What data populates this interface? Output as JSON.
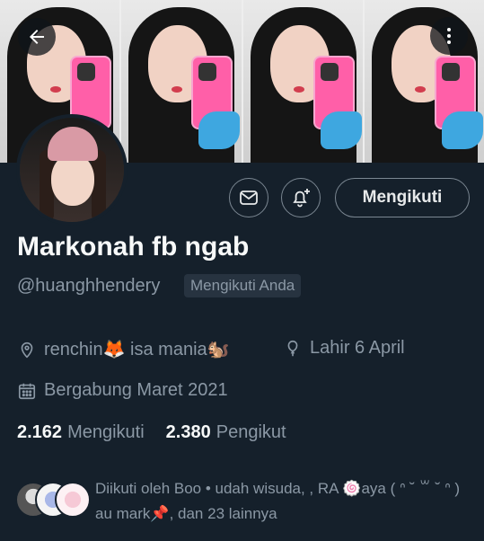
{
  "header": {
    "back_icon": "arrow-left-icon",
    "more_icon": "more-vertical-icon",
    "panels": 4
  },
  "profile": {
    "name": "Markonah fb ngab",
    "handle": "@huanghhendery",
    "follows_you": "Mengikuti Anda",
    "location": "renchin🦊 isa mania🐿️",
    "birthday": "Lahir 6 April",
    "joined": "Bergabung Maret 2021"
  },
  "actions": {
    "message_icon": "mail-icon",
    "notify_icon": "bell-plus-icon",
    "follow_label": "Mengikuti"
  },
  "stats": {
    "following_count": "2.162",
    "following_label": "Mengikuti",
    "followers_count": "2.380",
    "followers_label": "Pengikut"
  },
  "followed_by": {
    "text": "Diikuti oleh Boo • udah wisuda, , RA 🍥aya ( ᐢ ˘ ꒳ ˘ ᐢ ) au mark📌, dan 23 lainnya"
  },
  "colors": {
    "background": "#15202b",
    "secondary_text": "#8b98a5",
    "primary_text": "#e7e9ea"
  }
}
